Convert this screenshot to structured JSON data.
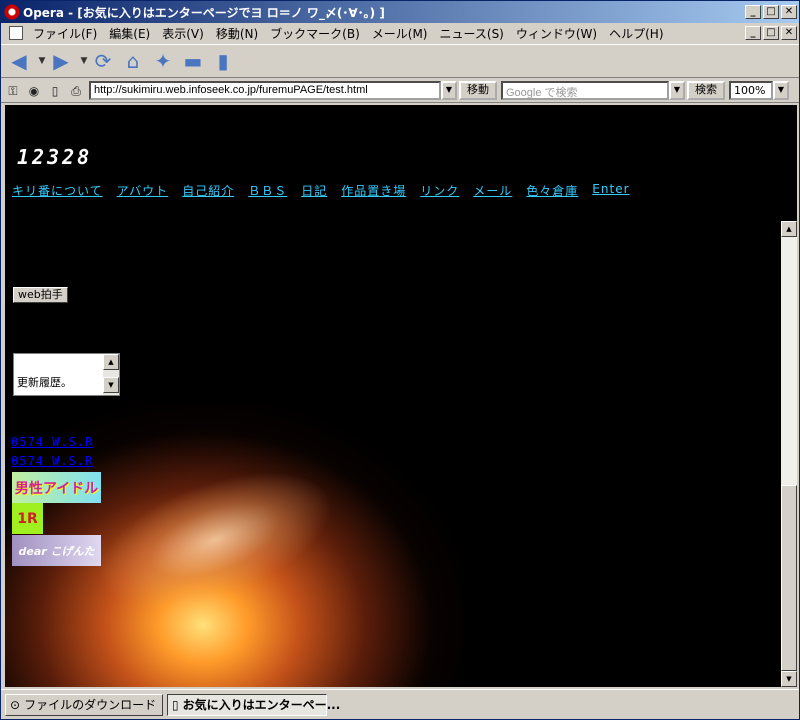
{
  "window": {
    "title": "Opera - [お気に入りはエンターページでヨ ロ＝ノ ワ_〆(･∀･｡) ]",
    "minimize": "_",
    "maximize": "□",
    "close": "✕"
  },
  "menu": [
    "ファイル(F)",
    "編集(E)",
    "表示(V)",
    "移動(N)",
    "ブックマーク(B)",
    "メール(M)",
    "ニュース(S)",
    "ウィンドウ(W)",
    "ヘルプ(H)"
  ],
  "address": {
    "url": "http://sukimiru.web.infoseek.co.jp/furemuPAGE/test.html",
    "go_label": "移動",
    "search_placeholder": "Google で検索",
    "search_label": "検索",
    "zoom": "100%"
  },
  "page": {
    "counter": "12328",
    "nav_links": [
      "キリ番について",
      "アバウト",
      "自己紹介",
      "ＢＢＳ",
      "日記",
      "作品置き場",
      "リンク",
      "メール",
      "色々倉庫",
      "Enter"
    ],
    "clap_button": "web拍手",
    "history_text": "更新履歴。",
    "site_link_1": "0574 W.S.R",
    "site_link_2": "0574 W.S.R",
    "banner_1": "男性アイドル",
    "banner_2": "1R",
    "banner_3": "dear こげんた"
  },
  "colors": {
    "link_cyan": "#33ccff",
    "link_blue": "#0000ff",
    "titlebar_start": "#0a246a"
  },
  "taskbar": {
    "tab_1": "ファイルのダウンロード",
    "tab_2": "お気に入りはエンターペー..."
  }
}
